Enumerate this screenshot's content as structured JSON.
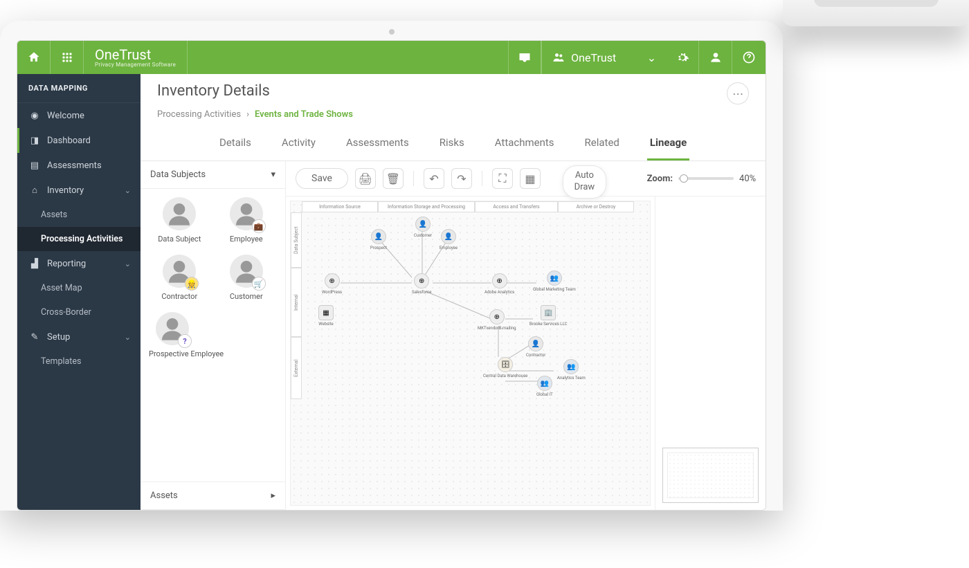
{
  "brand": {
    "name": "OneTrust",
    "sub": "Privacy Management Software"
  },
  "org": {
    "label": "OneTrust"
  },
  "sidebar": {
    "section": "DATA MAPPING",
    "items": [
      {
        "label": "Welcome"
      },
      {
        "label": "Dashboard"
      },
      {
        "label": "Assessments"
      },
      {
        "label": "Inventory"
      },
      {
        "label": "Reporting"
      },
      {
        "label": "Setup"
      }
    ],
    "inventory_children": [
      {
        "label": "Assets"
      },
      {
        "label": "Processing Activities"
      }
    ],
    "reporting_children": [
      {
        "label": "Asset Map"
      },
      {
        "label": "Cross-Border"
      }
    ],
    "setup_children": [
      {
        "label": "Templates"
      }
    ]
  },
  "page": {
    "title": "Inventory Details",
    "crumb_parent": "Processing Activities",
    "crumb_sep": "›",
    "crumb_active": "Events and Trade Shows"
  },
  "tabs": [
    "Details",
    "Activity",
    "Assessments",
    "Risks",
    "Attachments",
    "Related",
    "Lineage"
  ],
  "palette": {
    "accordion1": "Data Subjects",
    "accordion2": "Assets",
    "items": [
      {
        "label": "Data Subject"
      },
      {
        "label": "Employee"
      },
      {
        "label": "Contractor"
      },
      {
        "label": "Customer"
      },
      {
        "label": "Prospective Employee"
      }
    ]
  },
  "toolbar": {
    "save": "Save",
    "autodraw1": "Auto",
    "autodraw2": "Draw",
    "zoom_label": "Zoom:",
    "zoom_value": "40%"
  },
  "diagram": {
    "columns": [
      "Information Source",
      "Information Storage and Processing",
      "Access and Transfers",
      "Archive or Destroy"
    ],
    "rows": [
      "Data Subject",
      "Internal",
      "External"
    ],
    "nodes": {
      "prospect": "Prospect",
      "customer": "Customer",
      "employee": "Employee",
      "wordpress": "WordPress",
      "website": "Website",
      "salesforce": "Salesforce",
      "adobe": "Adobe Analytics",
      "marketing": "Global Marketing Team",
      "mktvendor": "MKTvendorB-mailing",
      "brooke": "Brooke Services LLC",
      "contractor": "Contractor",
      "cdw": "Central Data Warehouse",
      "globalit": "Global IT",
      "analytics": "Analytics Team"
    }
  }
}
